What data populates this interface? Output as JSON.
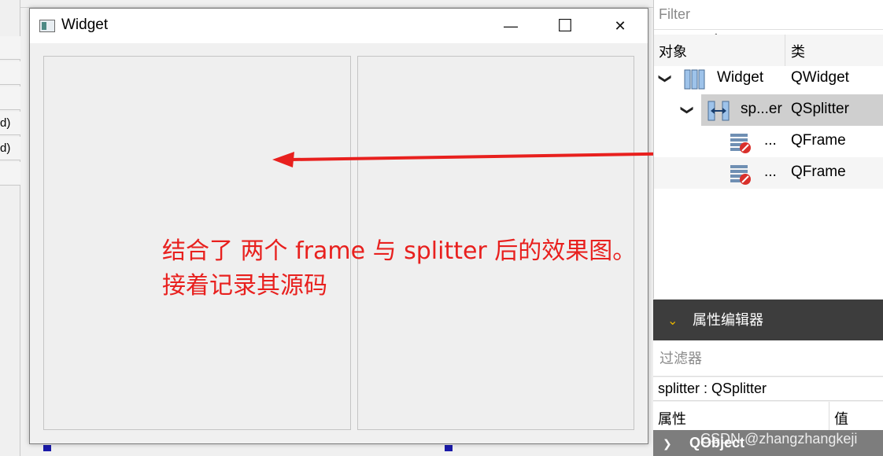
{
  "left_rows": [
    "",
    "",
    "",
    "d)",
    "d)",
    ""
  ],
  "window": {
    "title": "Widget",
    "minimize_glyph": "—",
    "maximize_glyph": "☐",
    "close_glyph": "✕"
  },
  "annotation": {
    "line1": "结合了 两个 frame 与 splitter 后的效果图。",
    "line2": "接着记录其源码",
    "color": "#e8201e"
  },
  "object_inspector": {
    "filter_placeholder": "Filter",
    "col_object": "对象",
    "col_class": "类",
    "rows": [
      {
        "name": "Widget",
        "class": "QWidget"
      },
      {
        "name": "sp...er",
        "class": "QSplitter"
      },
      {
        "name": "...",
        "class": "QFrame"
      },
      {
        "name": "...",
        "class": "QFrame"
      }
    ]
  },
  "property_editor": {
    "title": "属性编辑器",
    "filter_placeholder": "过滤器",
    "object_label": "splitter : QSplitter",
    "col_property": "属性",
    "col_value": "值",
    "group": "QObject"
  },
  "watermark": "CSDN @zhangzhangkeji"
}
